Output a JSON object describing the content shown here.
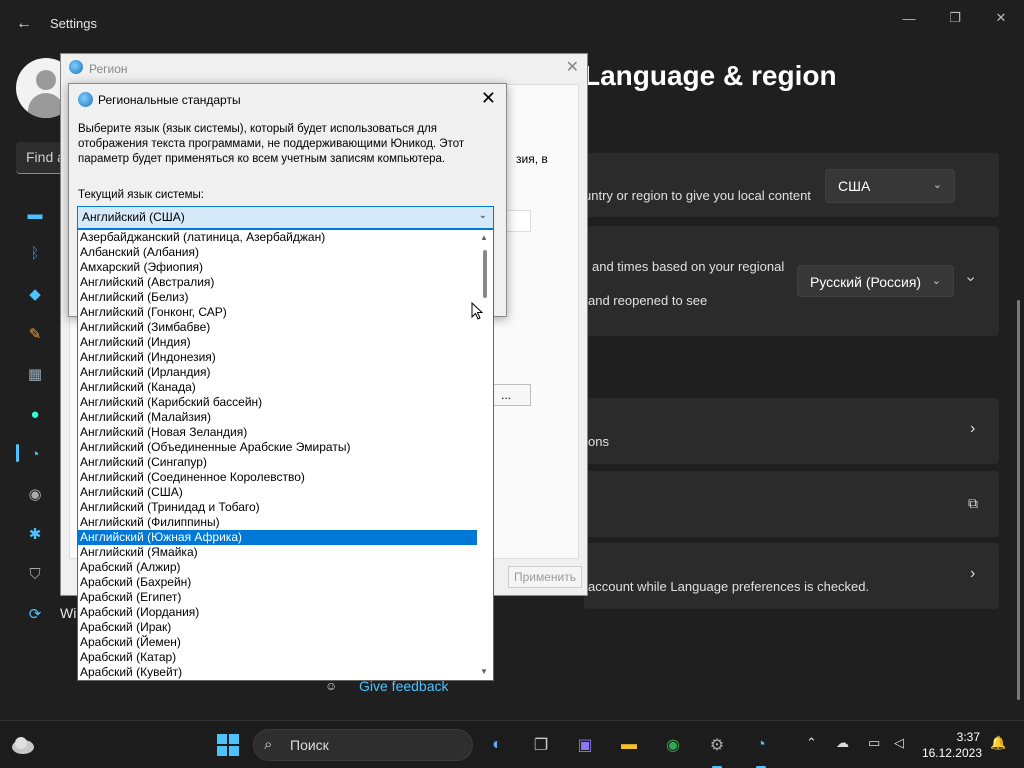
{
  "settings": {
    "app_title": "Settings",
    "search_placeholder": "Find a",
    "page_title": "Language & region",
    "nav_partial_label": "Wi",
    "country_text": "untry or region to give you local content",
    "country_value": "США",
    "regional_format_text_1": "and times based on your regional",
    "regional_format_text_2": "and reopened to see",
    "regional_format_value": "Русский (Россия)",
    "admin_text": "ons",
    "typing_text": "account while Language preferences is checked.",
    "give_feedback": "Give feedback"
  },
  "region_dialog": {
    "title": "Регион",
    "partial_text": "зия, в",
    "button_partial": "...",
    "apply_label": "Применить"
  },
  "regional_standards_dialog": {
    "title": "Региональные стандарты",
    "description": "Выберите язык (язык системы), который будет использоваться для отображения текста программами, не поддерживающими Юникод. Этот параметр будет применяться ко всем учетным записям компьютера.",
    "current_label": "Текущий язык системы:",
    "selected_value": "Английский (США)",
    "options": [
      "Азербайджанский (латиница, Азербайджан)",
      "Албанский (Албания)",
      "Амхарский (Эфиопия)",
      "Английский (Австралия)",
      "Английский (Белиз)",
      "Английский (Гонконг, САР)",
      "Английский (Зимбабве)",
      "Английский (Индия)",
      "Английский (Индонезия)",
      "Английский (Ирландия)",
      "Английский (Канада)",
      "Английский (Карибский бассейн)",
      "Английский (Малайзия)",
      "Английский (Новая Зеландия)",
      "Английский (Объединенные Арабские Эмираты)",
      "Английский (Сингапур)",
      "Английский (Соединенное Королевство)",
      "Английский (США)",
      "Английский (Тринидад и Тобаго)",
      "Английский (Филиппины)",
      "Английский (Южная Африка)",
      "Английский (Ямайка)",
      "Арабский (Алжир)",
      "Арабский (Бахрейн)",
      "Арабский (Египет)",
      "Арабский (Иордания)",
      "Арабский (Ирак)",
      "Арабский (Йемен)",
      "Арабский (Катар)",
      "Арабский (Кувейт)"
    ],
    "highlighted_index": 20
  },
  "taskbar": {
    "search_label": "Поиск",
    "time": "3:37",
    "date": "16.12.2023"
  },
  "colors": {
    "accent": "#4cc2ff",
    "selection": "#0078d7",
    "dark_bg": "#1f1f1f",
    "card_bg": "#2b2b2b"
  }
}
